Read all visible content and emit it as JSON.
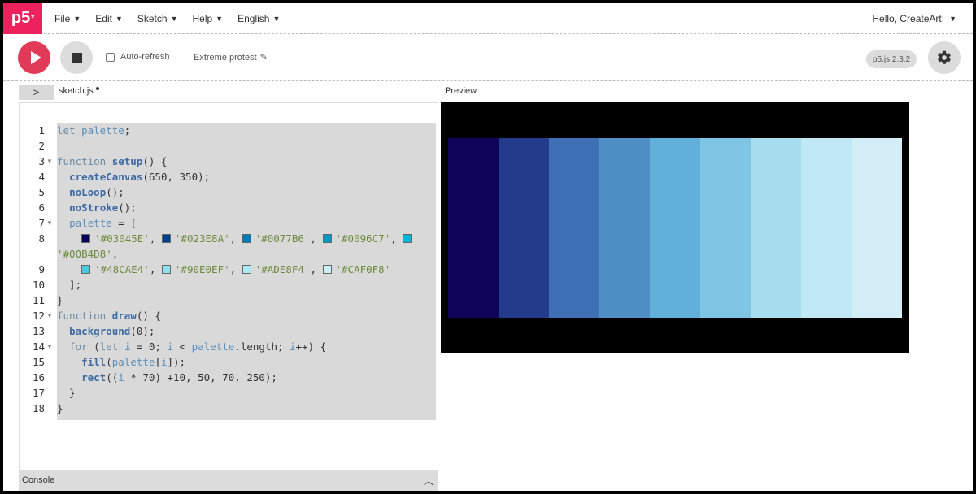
{
  "app": {
    "logo_text": "p5",
    "logo_sup": "*"
  },
  "menu": [
    {
      "label": "File"
    },
    {
      "label": "Edit"
    },
    {
      "label": "Sketch"
    },
    {
      "label": "Help"
    },
    {
      "label": "English"
    }
  ],
  "user": {
    "greeting": "Hello, CreateArt!"
  },
  "toolbar": {
    "auto_refresh_label": "Auto-refresh",
    "auto_refresh_checked": false,
    "sketch_name": "Extreme protest",
    "version": "p5.js 2.3.2"
  },
  "editor": {
    "file_tab": "sketch.js",
    "unsaved": true,
    "code": [
      [
        [
          "kw",
          "let "
        ],
        [
          "var",
          "palette"
        ],
        [
          "plain",
          ";"
        ]
      ],
      [],
      [
        [
          "kw",
          "function "
        ],
        [
          "fn",
          "setup"
        ],
        [
          "plain",
          "() {"
        ]
      ],
      [
        [
          "plain",
          "  "
        ],
        [
          "fn",
          "createCanvas"
        ],
        [
          "plain",
          "(650, 350);"
        ]
      ],
      [
        [
          "plain",
          "  "
        ],
        [
          "fn",
          "noLoop"
        ],
        [
          "plain",
          "();"
        ]
      ],
      [
        [
          "plain",
          "  "
        ],
        [
          "fn",
          "noStroke"
        ],
        [
          "plain",
          "();"
        ]
      ],
      [
        [
          "plain",
          "  "
        ],
        [
          "var",
          "palette"
        ],
        [
          "plain",
          " = ["
        ]
      ],
      [
        [
          "plain",
          "    "
        ],
        [
          "sw",
          "#03045E"
        ],
        [
          "str",
          "'#03045E'"
        ],
        [
          "plain",
          ", "
        ],
        [
          "sw",
          "#023E8A"
        ],
        [
          "str",
          "'#023E8A'"
        ],
        [
          "plain",
          ", "
        ],
        [
          "sw",
          "#0077B6"
        ],
        [
          "str",
          "'#0077B6'"
        ],
        [
          "plain",
          ", "
        ],
        [
          "sw",
          "#0096C7"
        ],
        [
          "str",
          "'#0096C7'"
        ],
        [
          "plain",
          ", "
        ],
        [
          "sw",
          "#00B4D8"
        ]
      ],
      [
        [
          "str",
          "'#00B4D8'"
        ],
        [
          "plain",
          ","
        ]
      ],
      [
        [
          "plain",
          "    "
        ],
        [
          "sw",
          "#48CAE4"
        ],
        [
          "str",
          "'#48CAE4'"
        ],
        [
          "plain",
          ", "
        ],
        [
          "sw",
          "#90E0EF"
        ],
        [
          "str",
          "'#90E0EF'"
        ],
        [
          "plain",
          ", "
        ],
        [
          "sw",
          "#ADE8F4"
        ],
        [
          "str",
          "'#ADE8F4'"
        ],
        [
          "plain",
          ", "
        ],
        [
          "sw",
          "#CAF0F8"
        ],
        [
          "str",
          "'#CAF0F8'"
        ]
      ],
      [
        [
          "plain",
          "  ];"
        ]
      ],
      [
        [
          "plain",
          "}"
        ]
      ],
      [
        [
          "kw",
          "function "
        ],
        [
          "fn",
          "draw"
        ],
        [
          "plain",
          "() {"
        ]
      ],
      [
        [
          "plain",
          "  "
        ],
        [
          "fn",
          "background"
        ],
        [
          "plain",
          "(0);"
        ]
      ],
      [
        [
          "plain",
          "  "
        ],
        [
          "kw",
          "for "
        ],
        [
          "plain",
          "("
        ],
        [
          "kw",
          "let "
        ],
        [
          "var",
          "i"
        ],
        [
          "plain",
          " = 0; "
        ],
        [
          "var",
          "i"
        ],
        [
          "plain",
          " < "
        ],
        [
          "var",
          "palette"
        ],
        [
          "plain",
          ".length; "
        ],
        [
          "var",
          "i"
        ],
        [
          "plain",
          "++) {"
        ]
      ],
      [
        [
          "plain",
          "    "
        ],
        [
          "fn",
          "fill"
        ],
        [
          "plain",
          "("
        ],
        [
          "var",
          "palette"
        ],
        [
          "plain",
          "["
        ],
        [
          "var",
          "i"
        ],
        [
          "plain",
          "]);"
        ]
      ],
      [
        [
          "plain",
          "    "
        ],
        [
          "fn",
          "rect"
        ],
        [
          "plain",
          "(("
        ],
        [
          "var",
          "i"
        ],
        [
          "plain",
          " * 70) +10, 50, 70, 250);"
        ]
      ],
      [
        [
          "plain",
          "  }"
        ]
      ],
      [
        [
          "plain",
          "}"
        ]
      ]
    ],
    "line_numbers": [
      "1",
      "2",
      "3",
      "4",
      "5",
      "6",
      "7",
      "8",
      "",
      "9",
      "10",
      "11",
      "12",
      "13",
      "14",
      "15",
      "16",
      "17",
      "18"
    ],
    "fold_lines": [
      2,
      6,
      12,
      14
    ]
  },
  "console": {
    "label": "Console"
  },
  "preview": {
    "label": "Preview",
    "swatches": [
      "#0d0358",
      "#233b8a",
      "#3d70b4",
      "#4e90c6",
      "#61b0d9",
      "#7ec6e4",
      "#a6ddef",
      "#bfe7f4",
      "#d4eef8"
    ]
  }
}
